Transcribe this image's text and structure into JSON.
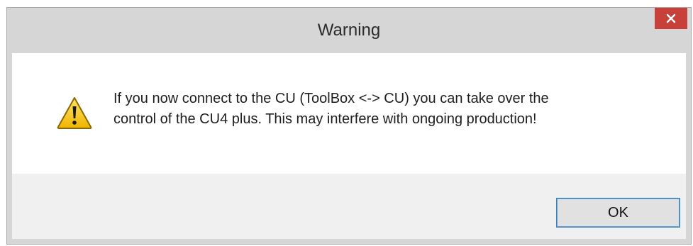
{
  "window": {
    "title": "Warning",
    "close_icon": "close-icon"
  },
  "dialog": {
    "icon": "warning-icon",
    "message_line1": "If you now connect to the CU (ToolBox <-> CU) you can take over the",
    "message_line2": "control of the CU4 plus. This may interfere with ongoing production!",
    "ok_label": "OK"
  },
  "colors": {
    "close_button": "#c7413a",
    "frame": "#d6d6d6",
    "ok_border": "#3c7fb1",
    "warning_yellow": "#f5c518"
  }
}
